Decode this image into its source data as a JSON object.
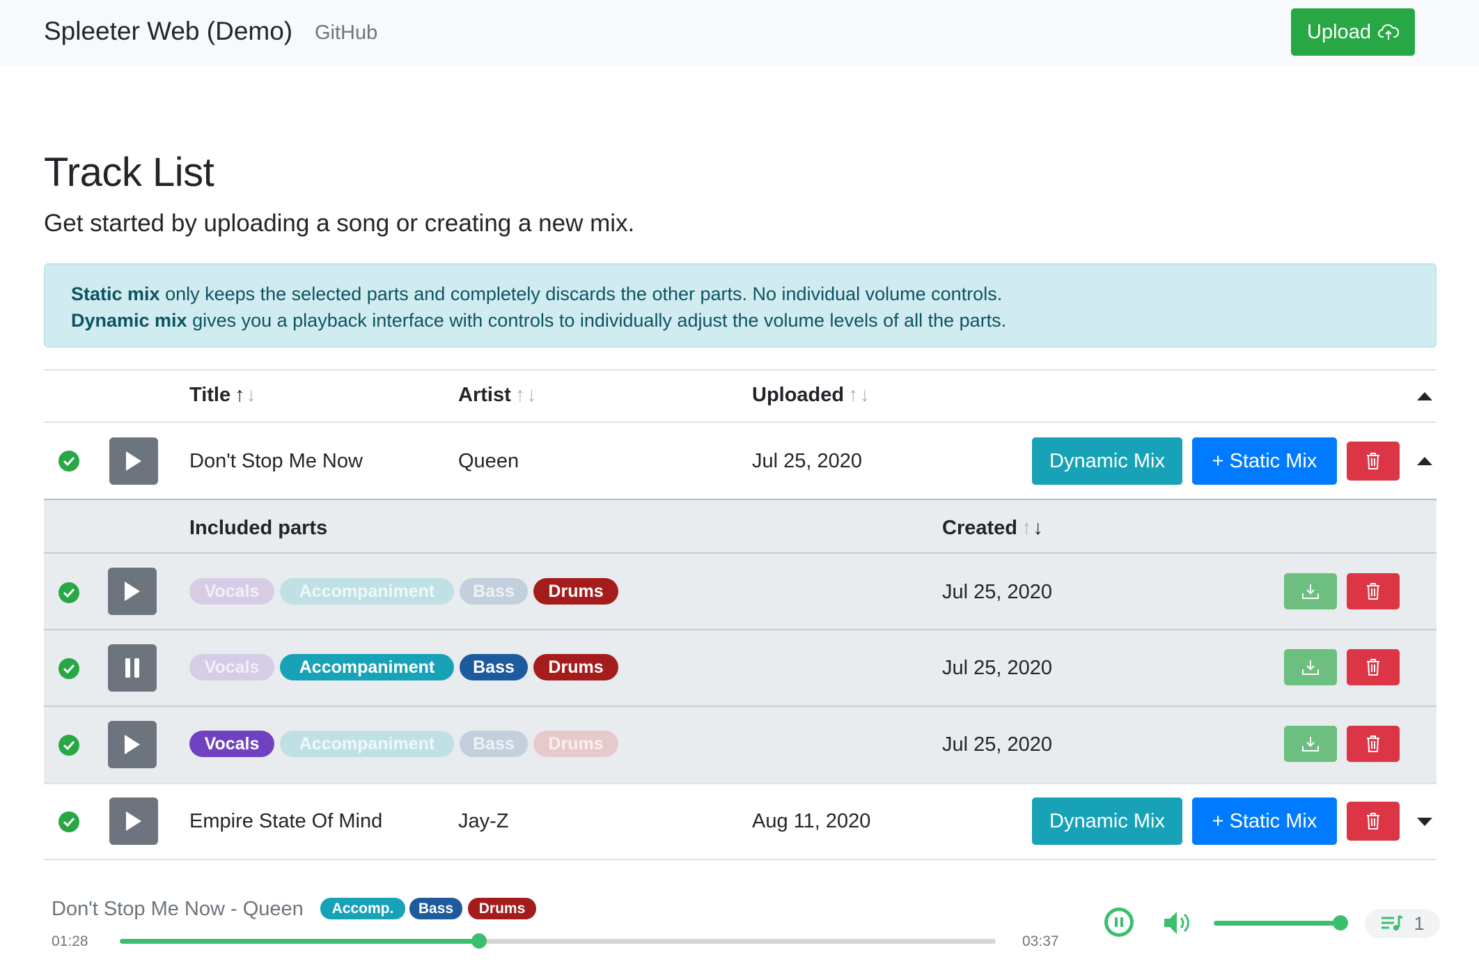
{
  "navbar": {
    "brand": "Spleeter Web (Demo)",
    "github": "GitHub",
    "upload": "Upload"
  },
  "page": {
    "title": "Track List",
    "lead": "Get started by uploading a song or creating a new mix.",
    "alert": {
      "static_label": "Static mix",
      "static_text": " only keeps the selected parts and completely discards the other parts. No individual volume controls.",
      "dynamic_label": "Dynamic mix",
      "dynamic_text": " gives you a playback interface with controls to individually adjust the volume levels of all the parts."
    }
  },
  "table": {
    "headers": {
      "title": "Title",
      "artist": "Artist",
      "uploaded": "Uploaded"
    },
    "sort_up": "↑",
    "sort_down": "↓",
    "rows": [
      {
        "title": "Don't Stop Me Now",
        "artist": "Queen",
        "uploaded": "Jul 25, 2020",
        "dynamic": "Dynamic Mix",
        "static": "+ Static Mix",
        "expanded": true
      },
      {
        "title": "Empire State Of Mind",
        "artist": "Jay-Z",
        "uploaded": "Aug 11, 2020",
        "dynamic": "Dynamic Mix",
        "static": "+ Static Mix",
        "expanded": false
      }
    ],
    "subtable": {
      "headers": {
        "parts": "Included parts",
        "created": "Created"
      },
      "rows": [
        {
          "created": "Jul 25, 2020",
          "playing": false,
          "parts": {
            "vocals": false,
            "accompaniment": false,
            "bass": false,
            "drums": true
          }
        },
        {
          "created": "Jul 25, 2020",
          "playing": true,
          "parts": {
            "vocals": false,
            "accompaniment": true,
            "bass": true,
            "drums": true
          }
        },
        {
          "created": "Jul 25, 2020",
          "playing": false,
          "parts": {
            "vocals": true,
            "accompaniment": false,
            "bass": false,
            "drums": false
          }
        }
      ],
      "labels": {
        "vocals": "Vocals",
        "accompaniment": "Accompaniment",
        "bass": "Bass",
        "drums": "Drums"
      }
    }
  },
  "player": {
    "now_playing": "Don't Stop Me Now - Queen",
    "badges": [
      "Accomp.",
      "Bass",
      "Drums"
    ],
    "elapsed": "01:28",
    "duration": "03:37",
    "progress": 0.41,
    "volume": 1.0,
    "queue_count": "1"
  },
  "colors": {
    "success": "#28a745",
    "info": "#17a2b8",
    "primary": "#007bff",
    "danger": "#dc3545",
    "secondary": "#6c757d"
  }
}
